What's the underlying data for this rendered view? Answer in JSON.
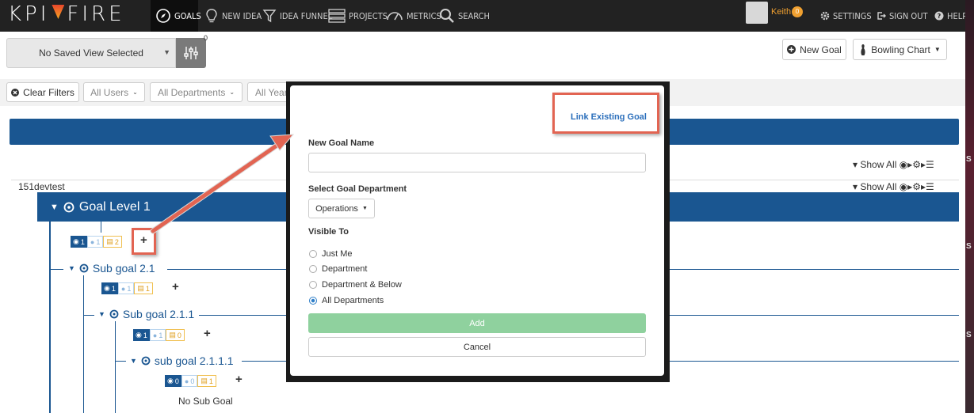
{
  "nav": {
    "logo_left": "KPI",
    "logo_right": "FIRE",
    "items": [
      {
        "label": "GOALS"
      },
      {
        "label": "NEW IDEA"
      },
      {
        "label": "IDEA FUNNEL"
      },
      {
        "label": "PROJECTS"
      },
      {
        "label": "METRICS"
      },
      {
        "label": "SEARCH"
      },
      {
        "label": "SETTINGS"
      },
      {
        "label": "SIGN OUT"
      },
      {
        "label": "HELP"
      }
    ],
    "user": {
      "name": "Keith",
      "badge": "0"
    }
  },
  "toolbar": {
    "saved_view": "No Saved View Selected",
    "filter_count": "0",
    "new_goal": "New Goal",
    "bowling_chart": "Bowling Chart"
  },
  "filters": {
    "clear": "Clear Filters",
    "users": "All Users",
    "departments": "All Departments",
    "years": "All Years"
  },
  "tree": {
    "show_all": "Show All",
    "root": "151devtest",
    "level1": "Goal Level 1",
    "level1_badges": {
      "goals": "1",
      "people": "1",
      "projects": "2"
    },
    "goals": [
      {
        "label": "Sub goal 2.1",
        "badges": {
          "goals": "1",
          "people": "1",
          "projects": "1"
        }
      },
      {
        "label": "Sub goal 2.1.1",
        "badges": {
          "goals": "1",
          "people": "1",
          "projects": "0"
        }
      },
      {
        "label": "sub goal 2.1.1.1",
        "badges": {
          "goals": "0",
          "people": "0",
          "projects": "1"
        }
      }
    ],
    "no_sub_goal": "No Sub Goal",
    "right_edge": [
      "S",
      "S",
      "S"
    ]
  },
  "modal": {
    "link_existing": "Link Existing Goal",
    "name_label": "New Goal Name",
    "name_value": "",
    "department_label": "Select Goal Department",
    "department_value": "Operations",
    "visible_label": "Visible To",
    "visible_options": [
      "Just Me",
      "Department",
      "Department & Below",
      "All Departments"
    ],
    "visible_selected": "All Departments",
    "add": "Add",
    "cancel": "Cancel"
  },
  "colors": {
    "nav_bg": "#222222",
    "brand_blue": "#1a5691",
    "highlight": "#e26452",
    "add_green": "#8fd19e",
    "user_orange": "#f0a030"
  }
}
